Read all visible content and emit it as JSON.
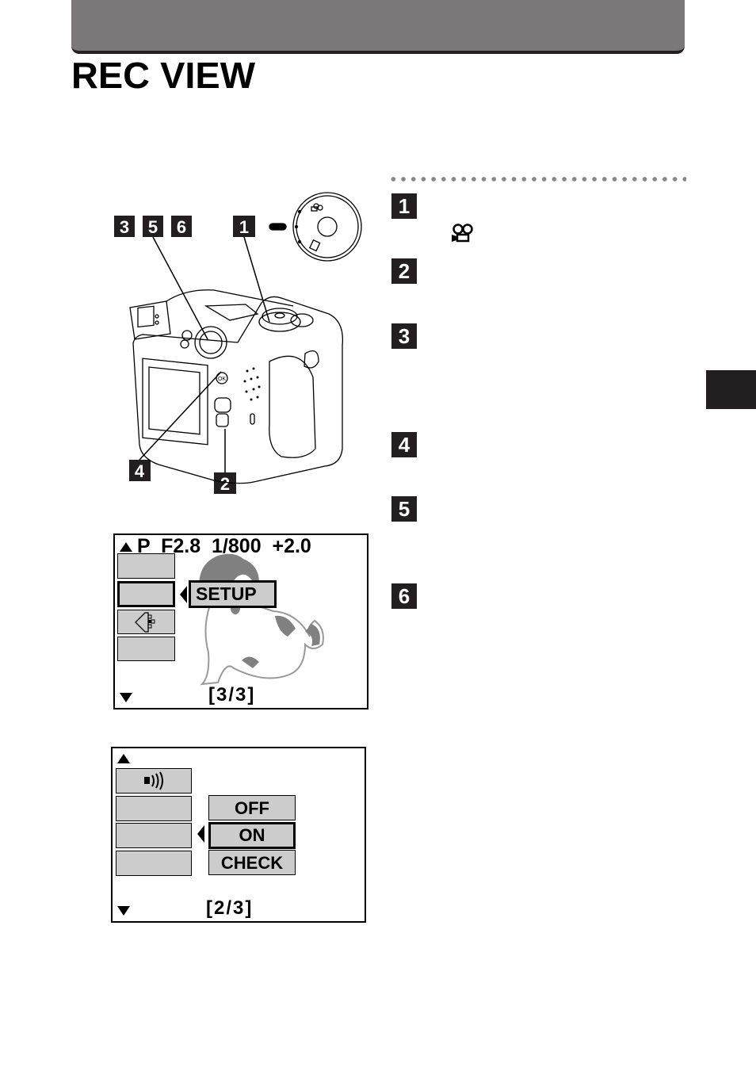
{
  "page": {
    "title": "REC VIEW",
    "header_bar_color": "#7a7879",
    "badge_color": "#231f20"
  },
  "camera_illustration": {
    "callouts": [
      "3",
      "5",
      "6",
      "1",
      "4",
      "2"
    ],
    "mode_dial_icons": [
      "movie-icon",
      "auto-icon"
    ]
  },
  "steps": [
    {
      "number": "1",
      "icon": "movie-camera-icon"
    },
    {
      "number": "2"
    },
    {
      "number": "3"
    },
    {
      "number": "4"
    },
    {
      "number": "5"
    },
    {
      "number": "6"
    }
  ],
  "lcd_screen_1": {
    "status_line": "P  F2.8  1/800  +2.0",
    "mode": "P",
    "aperture": "F2.8",
    "shutter": "1/800",
    "exposure_comp": "+2.0",
    "selected_label": "SETUP",
    "page_indicator": "[3/3]",
    "slot_icons": [
      "",
      "",
      "card-setup-icon",
      ""
    ]
  },
  "lcd_screen_2": {
    "slot_icons": [
      "sound-icon",
      "",
      "",
      ""
    ],
    "options": [
      "OFF",
      "ON",
      "CHECK"
    ],
    "selected_option": "ON",
    "page_indicator": "[2/3]"
  }
}
